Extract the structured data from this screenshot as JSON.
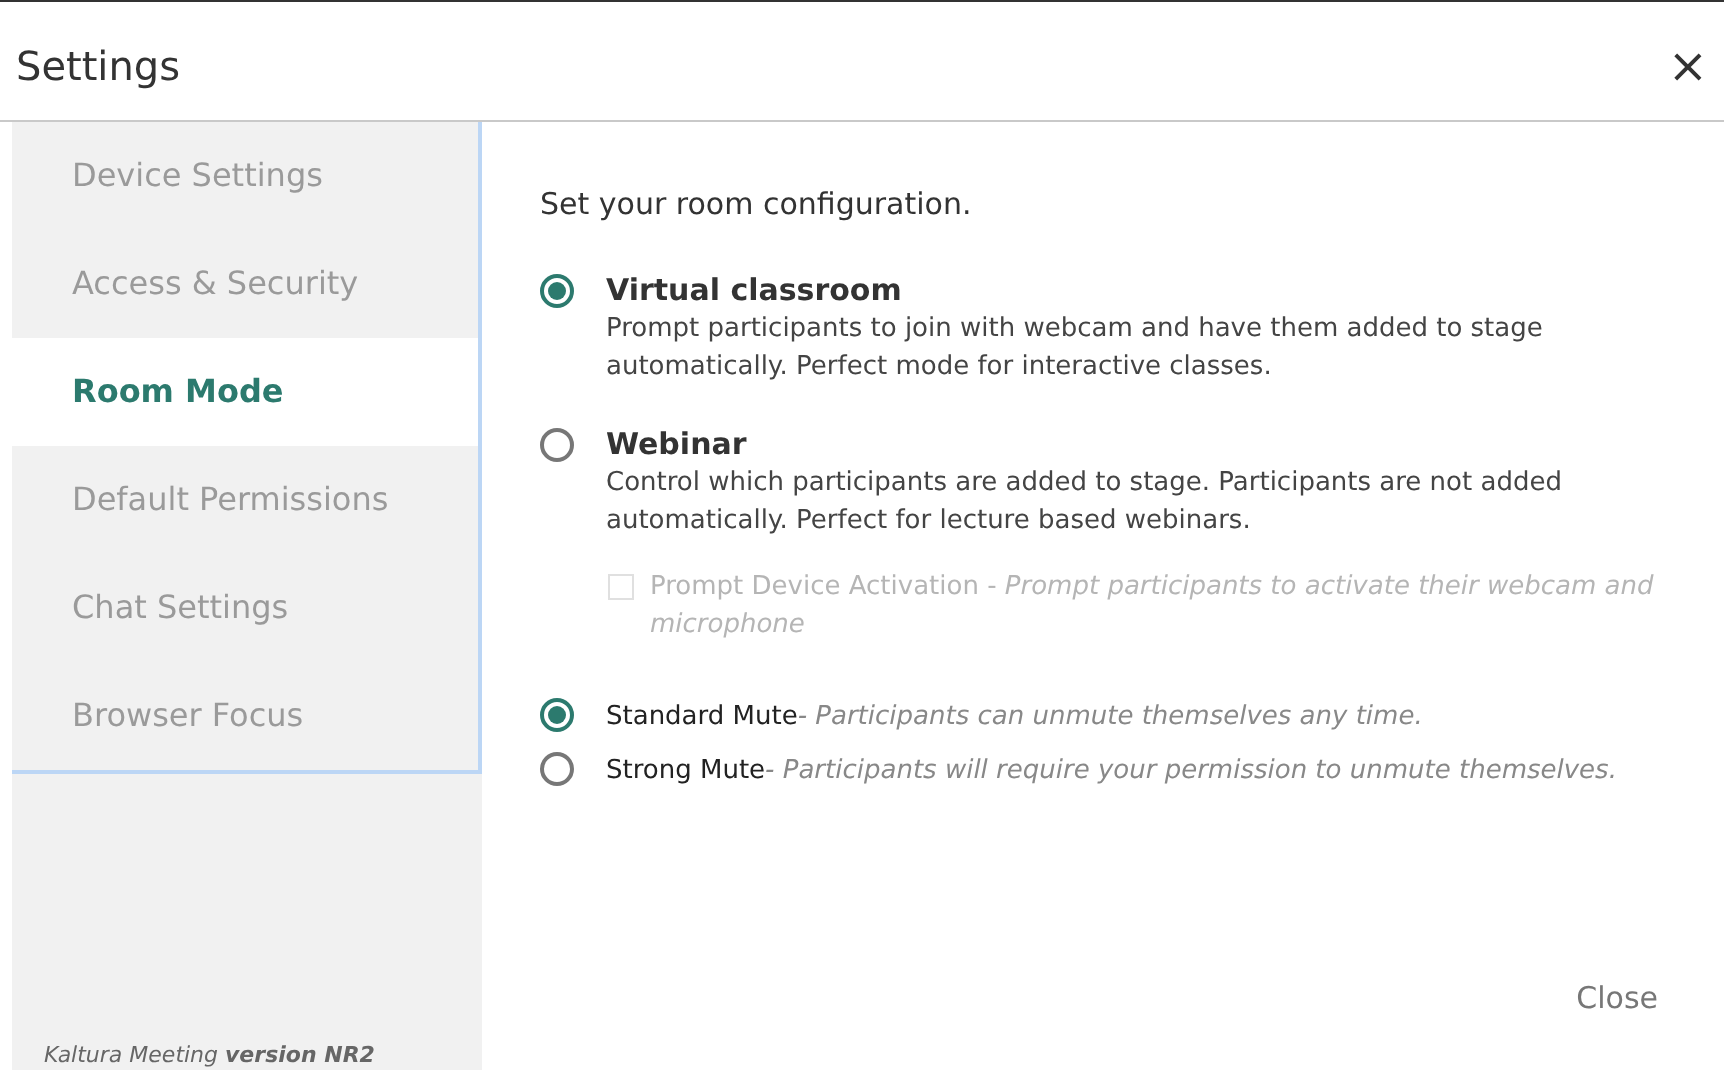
{
  "window": {
    "title": "Settings",
    "close": "×"
  },
  "sidebar": {
    "items": [
      {
        "label": "Device Settings",
        "selected": false
      },
      {
        "label": "Access & Security",
        "selected": false
      },
      {
        "label": "Room Mode",
        "selected": true
      },
      {
        "label": "Default Permissions",
        "selected": false
      },
      {
        "label": "Chat Settings",
        "selected": false
      },
      {
        "label": "Browser Focus",
        "selected": false
      }
    ],
    "footer": "Kaltura Meeting **version NR2**"
  },
  "content": {
    "intro": "Set your room configuration.",
    "modes": [
      {
        "title": "Virtual classroom",
        "description": "Prompt participants to join with webcam and have them added to stage automatically. Perfect mode for interactive classes.",
        "selected": true
      },
      {
        "title": "Webinar",
        "description": "Control which participants are added to stage. Participants are not added automatically. Perfect for lecture based webinars.",
        "selected": false
      }
    ],
    "prompt_option": {
      "text": "Prompt Device Activation - *Prompt participants to activate their webcam and microphone*",
      "checked": false,
      "disabled": true
    },
    "mutes": [
      {
        "label": "Standard Mute",
        "description": "- Participants can unmute themselves any time.",
        "selected": true
      },
      {
        "label": "Strong Mute",
        "description": "- Participants will require your permission to unmute themselves.",
        "selected": false
      }
    ],
    "close_button": "Close"
  }
}
